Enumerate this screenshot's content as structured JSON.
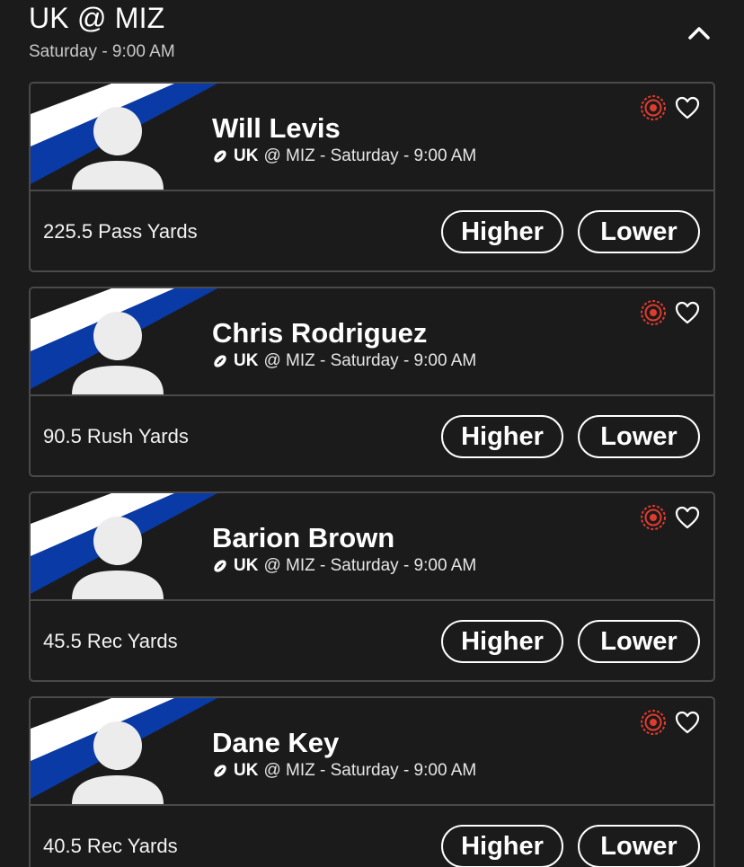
{
  "game": {
    "title": "UK @ MIZ",
    "time": "Saturday - 9:00 AM"
  },
  "colors": {
    "background": "#1b1b1b",
    "card_border": "#4a4a4a",
    "stripe_blue": "#0a3aa6",
    "stripe_white": "#ffffff",
    "avatar": "#ececec",
    "target_icon": "#e03b2f"
  },
  "icons": {
    "collapse": "chevron-up-icon",
    "target": "target-icon",
    "favorite": "heart-icon",
    "sport": "football-icon"
  },
  "cards": [
    {
      "name": "Will Levis",
      "team": "UK",
      "matchup_rest": "@ MIZ - Saturday - 9:00 AM",
      "stat": "225.5 Pass Yards",
      "higher": "Higher",
      "lower": "Lower"
    },
    {
      "name": "Chris Rodriguez",
      "team": "UK",
      "matchup_rest": "@ MIZ - Saturday - 9:00 AM",
      "stat": "90.5 Rush Yards",
      "higher": "Higher",
      "lower": "Lower"
    },
    {
      "name": "Barion Brown",
      "team": "UK",
      "matchup_rest": "@ MIZ - Saturday - 9:00 AM",
      "stat": "45.5 Rec Yards",
      "higher": "Higher",
      "lower": "Lower"
    },
    {
      "name": "Dane Key",
      "team": "UK",
      "matchup_rest": "@ MIZ - Saturday - 9:00 AM",
      "stat": "40.5 Rec Yards",
      "higher": "Higher",
      "lower": "Lower"
    }
  ]
}
